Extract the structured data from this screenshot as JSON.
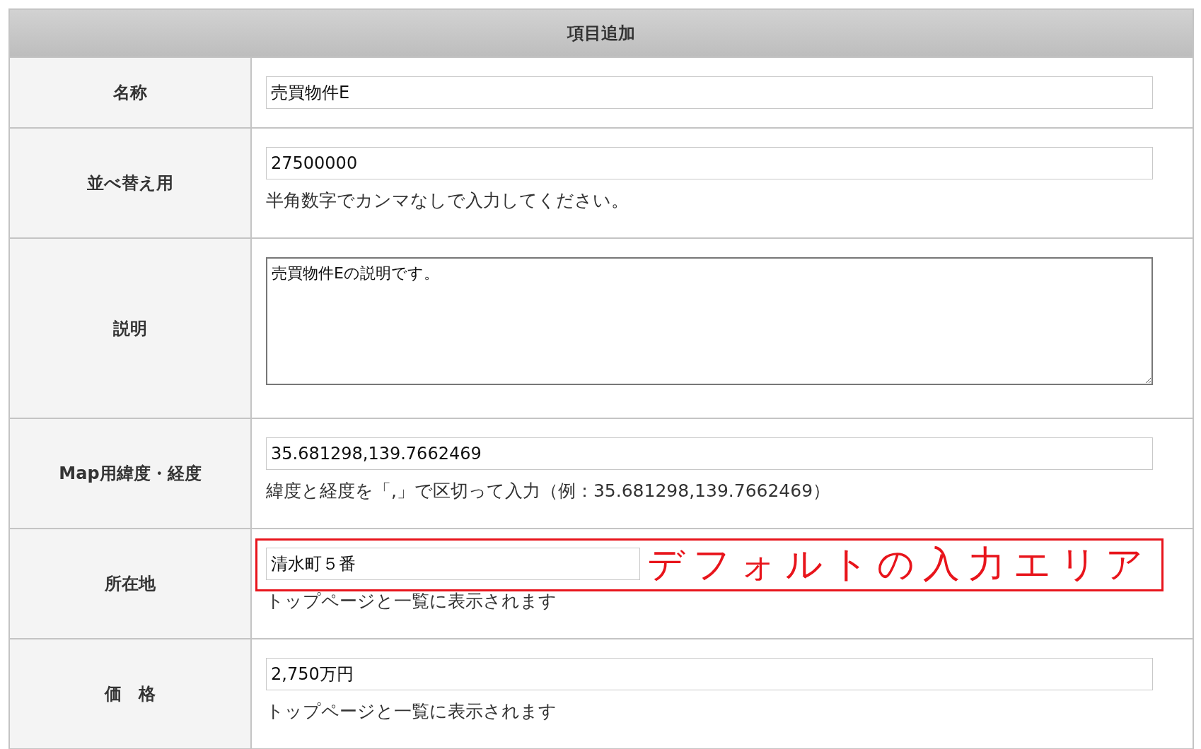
{
  "title": "項目追加",
  "fields": [
    {
      "label": "名称",
      "kind": "text",
      "value": "売買物件E"
    },
    {
      "label": "並べ替え用",
      "kind": "text",
      "value": "27500000",
      "note": "半角数字でカンマなしで入力してください。"
    },
    {
      "label": "説明",
      "kind": "textarea",
      "value": "売買物件Eの説明です。"
    },
    {
      "label": "Map用緯度・経度",
      "kind": "text",
      "value": "35.681298,139.7662469",
      "note": "緯度と経度を「,」で区切って入力（例：35.681298,139.7662469）"
    },
    {
      "label": "所在地",
      "kind": "text",
      "value": "清水町５番",
      "note": "トップページと一覧に表示されます",
      "annotation": "デフォルトの入力エリア"
    },
    {
      "label": "価　格",
      "kind": "text",
      "value": "2,750万円",
      "note": "トップページと一覧に表示されます"
    }
  ]
}
